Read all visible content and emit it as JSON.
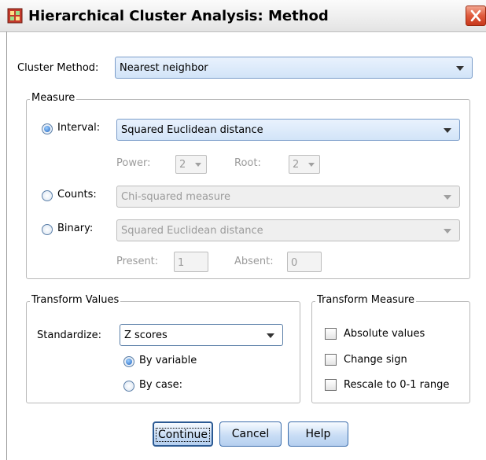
{
  "window": {
    "title": "Hierarchical Cluster Analysis: Method"
  },
  "cluster_method": {
    "label": "Cluster Method:",
    "value": "Nearest neighbor"
  },
  "measure": {
    "title": "Measure",
    "interval": {
      "label": "Interval:",
      "value": "Squared Euclidean distance",
      "power_label": "Power:",
      "power_value": "2",
      "root_label": "Root:",
      "root_value": "2"
    },
    "counts": {
      "label": "Counts:",
      "value": "Chi-squared measure"
    },
    "binary": {
      "label": "Binary:",
      "value": "Squared Euclidean distance",
      "present_label": "Present:",
      "present_value": "1",
      "absent_label": "Absent:",
      "absent_value": "0"
    }
  },
  "transform_values": {
    "title": "Transform Values",
    "standardize_label": "Standardize:",
    "standardize_value": "Z scores",
    "by_variable": "By variable",
    "by_case": "By case:"
  },
  "transform_measure": {
    "title": "Transform Measure",
    "absolute_values": "Absolute values",
    "change_sign": "Change sign",
    "rescale": "Rescale to 0-1 range"
  },
  "buttons": {
    "continue": "Continue",
    "cancel": "Cancel",
    "help": "Help"
  },
  "colors": {
    "accent": "#2b5a94",
    "close": "#e05a3c"
  }
}
